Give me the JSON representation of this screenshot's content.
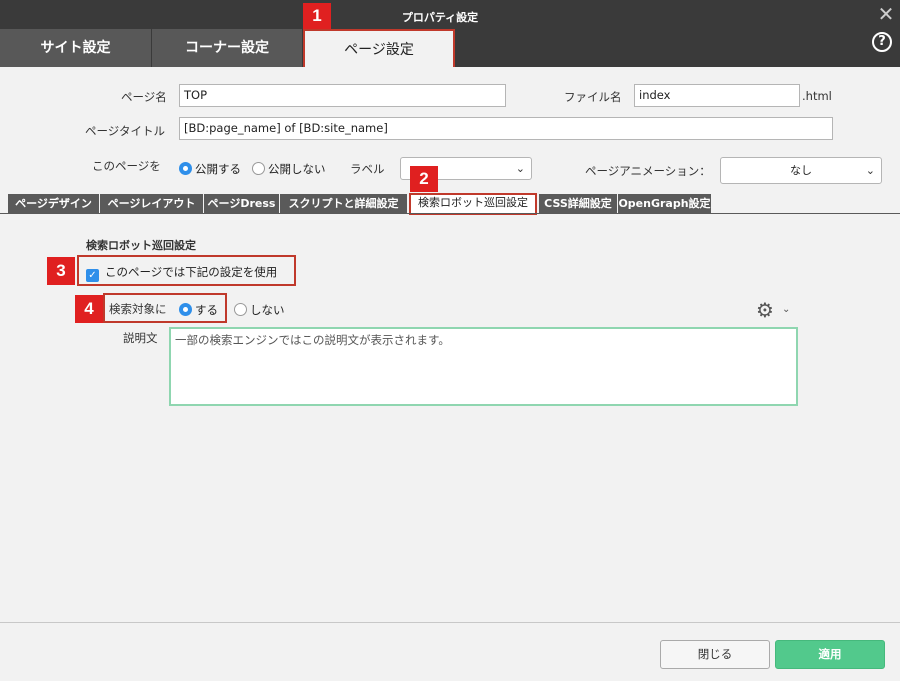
{
  "window": {
    "title": "プロパティ設定",
    "close_label": "✕",
    "help_label": "?"
  },
  "top_tabs": [
    {
      "label": "サイト設定"
    },
    {
      "label": "コーナー設定"
    },
    {
      "label": "ページ設定"
    }
  ],
  "markers": [
    "1",
    "2",
    "3",
    "4"
  ],
  "form": {
    "page_name_label": "ページ名",
    "page_name_value": "TOP",
    "file_name_label": "ファイル名",
    "file_name_value": "index",
    "file_ext": ".html",
    "page_title_label": "ページタイトル",
    "page_title_value": "[BD:page_name] of [BD:site_name]",
    "publish_label": "このページを",
    "publish_yes": "公開する",
    "publish_no": "公開しない",
    "label_label": "ラベル",
    "label_value": "",
    "animation_label": "ページアニメーション：",
    "animation_value": "なし"
  },
  "sub_tabs": [
    {
      "label": "ページデザイン"
    },
    {
      "label": "ページレイアウト"
    },
    {
      "label": "ページDress"
    },
    {
      "label": "スクリプトと詳細設定"
    },
    {
      "label": "検索ロボット巡回設定"
    },
    {
      "label": "CSS詳細設定"
    },
    {
      "label": "OpenGraph設定"
    }
  ],
  "robot": {
    "section_title": "検索ロボット巡回設定",
    "use_below_label": "このページでは下記の設定を使用",
    "target_label": "検索対象に",
    "target_yes": "する",
    "target_no": "しない",
    "description_label": "説明文",
    "description_placeholder": "一部の検索エンジンではこの説明文が表示されます。"
  },
  "footer": {
    "close_label": "閉じる",
    "apply_label": "適用"
  },
  "colors": {
    "accent": "#2f8fea",
    "apply": "#52c98c",
    "highlight": "#e02020",
    "titlebar": "#3a3a3a"
  }
}
